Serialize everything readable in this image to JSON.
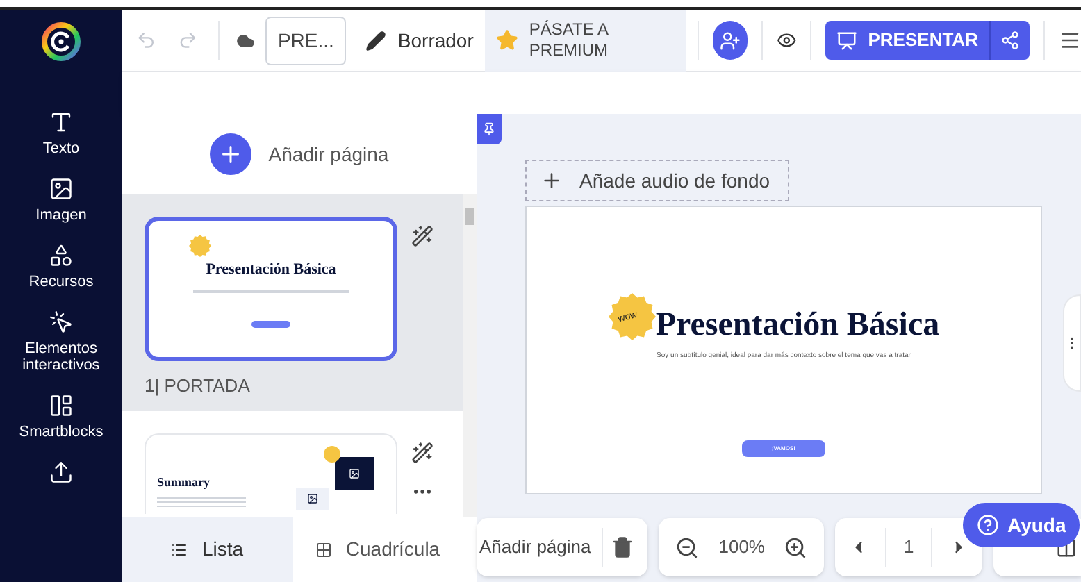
{
  "sidebar": {
    "items": [
      {
        "label": "Texto"
      },
      {
        "label": "Imagen"
      },
      {
        "label": "Recursos"
      },
      {
        "label": "Elementos interactivos"
      },
      {
        "label": "Smartblocks"
      }
    ]
  },
  "toolbar": {
    "project_name": "PRE...",
    "draft": "Borrador",
    "premium": "PÁSATE A PREMIUM",
    "present": "PRESENTAR"
  },
  "pages_panel": {
    "add_page": "Añadir página",
    "pages": [
      {
        "kind": "cover",
        "selected": true,
        "title": "Presentación Básica",
        "caption": "1| PORTADA"
      },
      {
        "kind": "summary",
        "selected": false,
        "title": "Summary"
      }
    ],
    "views": [
      {
        "label": "Lista",
        "selected": true
      },
      {
        "label": "Cuadrícula",
        "selected": false
      }
    ]
  },
  "canvas": {
    "audio": "Añade audio de fondo",
    "slide": {
      "sticker": "wow",
      "title": "Presentación Básica",
      "subtitle": "Soy un subtítulo genial, ideal para dar más contexto sobre el tema que vas a tratar",
      "button": "¡VAMOS!"
    }
  },
  "bottom_bar": {
    "add_page": "Añadir página",
    "zoom": "100%",
    "page": "1",
    "help": "Ayuda"
  }
}
